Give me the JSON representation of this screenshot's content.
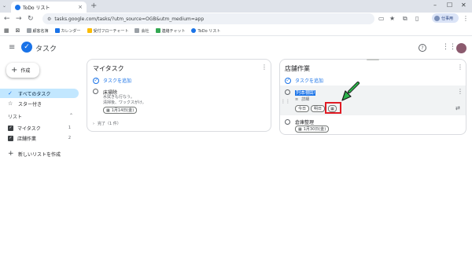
{
  "browser": {
    "tab_title": "ToDo リスト",
    "url": "tasks.google.com/tasks/?utm_source=OGB&utm_medium=app",
    "profile_label": "仕事用",
    "bookmarks": [
      "顧客名簿",
      "カレンダー",
      "受付フローチャート",
      "会社",
      "連絡チャット",
      "ToDo リスト"
    ]
  },
  "app": {
    "title": "タスク",
    "create_label": "作成"
  },
  "sidebar": {
    "all_tasks": "すべてのタスク",
    "starred": "スター付き",
    "lists_header": "リスト",
    "lists": [
      {
        "label": "マイタスク",
        "count": "1"
      },
      {
        "label": "店舗作業",
        "count": "2"
      }
    ],
    "new_list": "新しいリストを作成"
  },
  "mytasks": {
    "title": "マイタスク",
    "add_task": "タスクを追加",
    "task": {
      "title": "床掃除",
      "notes": [
        "水拭きも行なう。",
        "清掃後、ワックスがけ。"
      ],
      "date": "1月14日(金)"
    },
    "completed": "完了（1 件）"
  },
  "store": {
    "title": "店舗作業",
    "add_task": "タスクを追加",
    "tasks": [
      {
        "title": "列本棚卸",
        "details_placeholder": "詳細",
        "quick_dates": [
          "今日",
          "明日"
        ]
      },
      {
        "title": "倉庫整理",
        "date": "1月30日(金)"
      }
    ]
  },
  "colors": {
    "accent": "#1a73e8",
    "highlight": "#e01b24",
    "arrow": "#2bb34a"
  },
  "icons": [
    "search-icon",
    "star-icon",
    "calendar-icon",
    "check-icon",
    "kebab-icon",
    "repeat-icon"
  ]
}
